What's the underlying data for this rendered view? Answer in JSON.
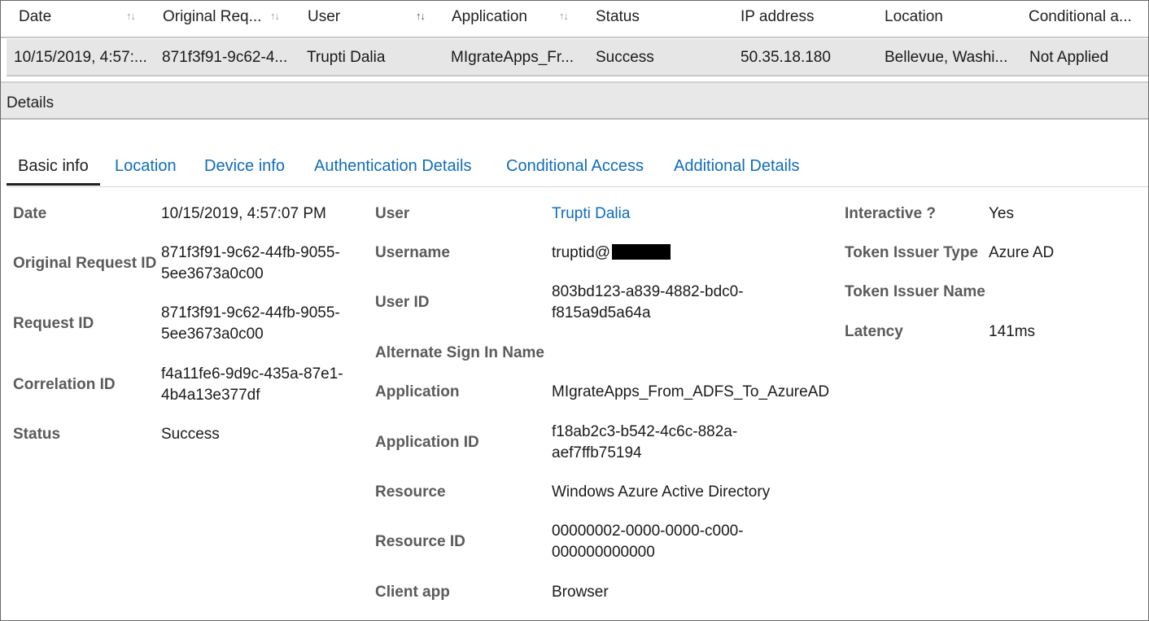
{
  "table": {
    "headers": [
      "Date",
      "Original Req...",
      "User",
      "Application",
      "Status",
      "IP address",
      "Location",
      "Conditional a..."
    ],
    "sort_icons": [
      "↑↓",
      "↑↓",
      "↑↓",
      "↑↓"
    ],
    "row": [
      "10/15/2019, 4:57:...",
      "871f3f91-9c62-4...",
      "Trupti Dalia",
      "MIgrateApps_Fr...",
      "Success",
      "50.35.18.180",
      "Bellevue, Washi...",
      "Not Applied"
    ]
  },
  "details_title": "Details",
  "tabs": [
    "Basic info",
    "Location",
    "Device info",
    "Authentication Details",
    "Conditional Access",
    "Additional Details"
  ],
  "basic_info": {
    "col1": [
      {
        "label": "Date",
        "value": [
          "10/15/2019, 4:57:07 PM"
        ]
      },
      {
        "label": "Original Request ID",
        "value": [
          "871f3f91-9c62-44fb-9055-",
          "5ee3673a0c00"
        ]
      },
      {
        "label": "Request ID",
        "value": [
          "871f3f91-9c62-44fb-9055-",
          "5ee3673a0c00"
        ]
      },
      {
        "label": "Correlation ID",
        "value": [
          "f4a11fe6-9d9c-435a-87e1-",
          "4b4a13e377df"
        ]
      },
      {
        "label": "Status",
        "value": [
          "Success"
        ]
      }
    ],
    "col2": [
      {
        "label": "User",
        "value": [
          "Trupti Dalia"
        ]
      },
      {
        "label": "Username",
        "value": [
          "truptid@"
        ]
      },
      {
        "label": "User ID",
        "value": [
          "803bd123-a839-4882-bdc0-",
          "f815a9d5a64a"
        ]
      },
      {
        "label": "Alternate Sign In Name",
        "value": []
      },
      {
        "label": "Application",
        "value": [
          "MIgrateApps_From_ADFS_To_AzureAD"
        ]
      },
      {
        "label": "Application ID",
        "value": [
          "f18ab2c3-b542-4c6c-882a-",
          "aef7ffb75194"
        ]
      },
      {
        "label": "Resource",
        "value": [
          "Windows Azure Active Directory"
        ]
      },
      {
        "label": "Resource ID",
        "value": [
          "00000002-0000-0000-c000-",
          "000000000000"
        ]
      },
      {
        "label": "Client app",
        "value": [
          "Browser"
        ]
      }
    ],
    "col3": [
      {
        "label": "Interactive ?",
        "value": [
          "Yes"
        ]
      },
      {
        "label": "Token Issuer Type",
        "value": [
          "Azure AD"
        ]
      },
      {
        "label": "Token Issuer Name",
        "value": []
      },
      {
        "label": "Latency",
        "value": [
          "141ms"
        ]
      }
    ]
  },
  "colors": {
    "link": "#0f6cbd",
    "selected_row": "#e6e6e6",
    "details_bar": "#e8e8e8"
  }
}
